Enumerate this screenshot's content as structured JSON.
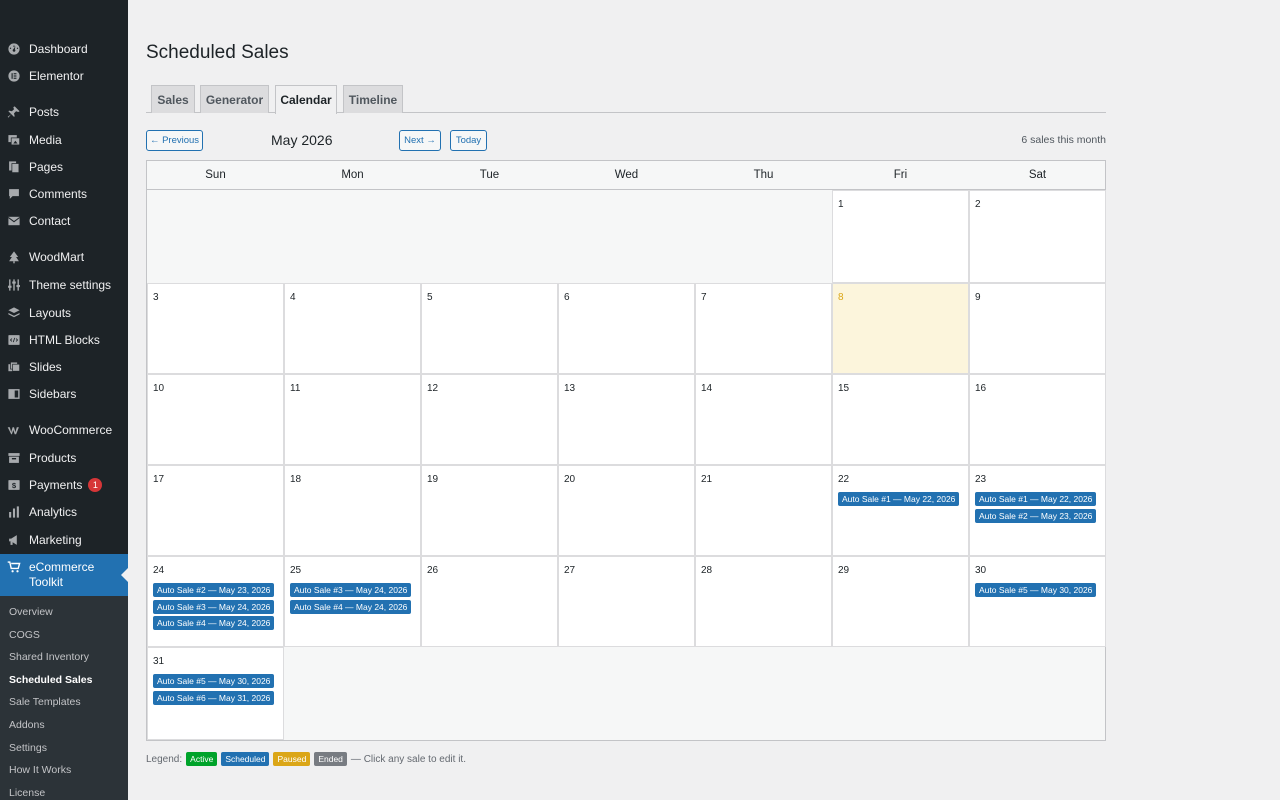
{
  "sidebar": {
    "items": [
      {
        "label": "Dashboard",
        "icon": "dashboard-icon"
      },
      {
        "label": "Elementor",
        "icon": "elementor-icon"
      },
      {
        "label": "Posts",
        "icon": "pin-icon"
      },
      {
        "label": "Media",
        "icon": "media-icon"
      },
      {
        "label": "Pages",
        "icon": "pages-icon"
      },
      {
        "label": "Comments",
        "icon": "comment-icon"
      },
      {
        "label": "Contact",
        "icon": "mail-icon"
      },
      {
        "label": "WoodMart",
        "icon": "woodmart-icon"
      },
      {
        "label": "Theme settings",
        "icon": "sliders-icon"
      },
      {
        "label": "Layouts",
        "icon": "layers-icon"
      },
      {
        "label": "HTML Blocks",
        "icon": "html-icon"
      },
      {
        "label": "Slides",
        "icon": "slides-icon"
      },
      {
        "label": "Sidebars",
        "icon": "sidebar-icon"
      },
      {
        "label": "WooCommerce",
        "icon": "woocommerce-icon"
      },
      {
        "label": "Products",
        "icon": "archive-icon"
      },
      {
        "label": "Payments",
        "icon": "dollar-icon",
        "badge": "1"
      },
      {
        "label": "Analytics",
        "icon": "bar-chart-icon"
      },
      {
        "label": "Marketing",
        "icon": "megaphone-icon"
      },
      {
        "label": "eCommerce Toolkit",
        "icon": "cart-icon"
      }
    ],
    "submenu": [
      "Overview",
      "COGS",
      "Shared Inventory",
      "Scheduled Sales",
      "Sale Templates",
      "Addons",
      "Settings",
      "How It Works",
      "License"
    ]
  },
  "page": {
    "title": "Scheduled Sales",
    "tabs": [
      "Sales",
      "Generator",
      "Calendar",
      "Timeline"
    ],
    "active_tab": "Calendar"
  },
  "calendar": {
    "prev_label": "← Previous",
    "month_label": "May 2026",
    "next_label": "Next →",
    "today_label": "Today",
    "sales_count": "6 sales this month",
    "weekdays": [
      "Sun",
      "Mon",
      "Tue",
      "Wed",
      "Thu",
      "Fri",
      "Sat"
    ],
    "first_weekday_index": 5,
    "days_in_month": 31,
    "today": 8,
    "events": {
      "22": [
        "Auto Sale #1 — May 22, 2026"
      ],
      "23": [
        "Auto Sale #1 — May 22, 2026",
        "Auto Sale #2 — May 23, 2026"
      ],
      "24": [
        "Auto Sale #2 — May 23, 2026",
        "Auto Sale #3 — May 24, 2026",
        "Auto Sale #4 — May 24, 2026"
      ],
      "25": [
        "Auto Sale #3 — May 24, 2026",
        "Auto Sale #4 — May 24, 2026"
      ],
      "30": [
        "Auto Sale #5 — May 30, 2026"
      ],
      "31": [
        "Auto Sale #5 — May 30, 2026",
        "Auto Sale #6 — May 31, 2026"
      ]
    }
  },
  "legend": {
    "label": "Legend:",
    "items": [
      {
        "label": "Active",
        "color": "#00a32a"
      },
      {
        "label": "Scheduled",
        "color": "#2271b1"
      },
      {
        "label": "Paused",
        "color": "#dba617"
      },
      {
        "label": "Ended",
        "color": "#787c82"
      }
    ],
    "note": "— Click any sale to edit it."
  },
  "colors": {
    "accent": "#2271b1",
    "sidebar_bg": "#1d2327",
    "today_bg": "#fcf5dc"
  }
}
